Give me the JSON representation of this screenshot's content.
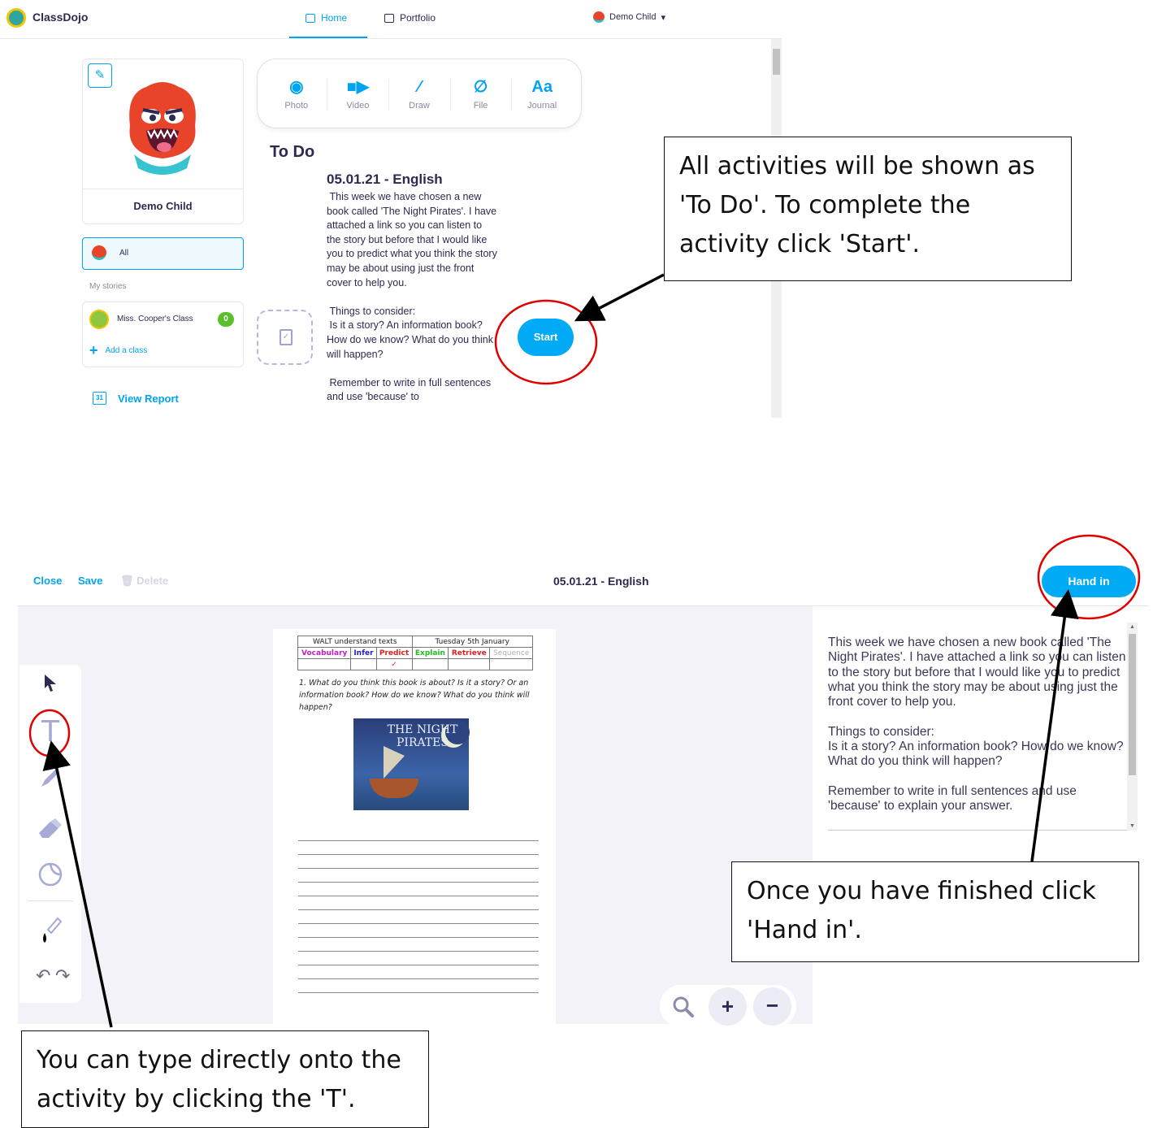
{
  "top_screen": {
    "app_name": "ClassDojo",
    "nav": {
      "home": "Home",
      "portfolio": "Portfolio"
    },
    "user_menu": "Demo Child",
    "profile": {
      "name": "Demo Child",
      "edit_icon": "pencil-icon"
    },
    "sidebar": {
      "all_label": "All",
      "my_stories": "My stories",
      "class_name": "Miss. Cooper's Class",
      "class_badge": "0",
      "add_class": "Add a class",
      "view_report": "View Report",
      "calendar_day": "31"
    },
    "post_options": [
      {
        "label": "Photo",
        "icon": "camera-icon",
        "glyph": "◉"
      },
      {
        "label": "Video",
        "icon": "video-icon",
        "glyph": "■▶"
      },
      {
        "label": "Draw",
        "icon": "brush-icon",
        "glyph": "⁄"
      },
      {
        "label": "File",
        "icon": "paperclip-icon",
        "glyph": "∅"
      },
      {
        "label": "Journal",
        "icon": "text-icon",
        "glyph": "Aa"
      }
    ],
    "todo_heading": "To Do",
    "activity": {
      "title": "05.01.21 - English",
      "body": " This week we have chosen a new book called 'The Night Pirates'. I have attached a link so you can listen to the story but before that I would like you to predict what you think the story may be about using just the front cover to help you.\n\n Things to consider:\n Is it a story? An information book? How do we know? What do you think will happen?\n\n Remember to write in full sentences and use 'because' to",
      "start_label": "Start"
    }
  },
  "bottom_screen": {
    "close": "Close",
    "save": "Save",
    "delete": "Delete",
    "title": "05.01.21 - English",
    "hand_in": "Hand in",
    "tools": [
      "select-arrow-icon",
      "text-tool-icon",
      "pen-icon",
      "eraser-icon",
      "sticker-icon",
      "color-dropper-icon",
      "undo-icon",
      "redo-icon"
    ],
    "text_tool_glyph": "T",
    "worksheet": {
      "walt": "WALT understand texts",
      "date": "Tuesday 5th January",
      "skills": [
        "Vocabulary",
        "Infer",
        "Predict",
        "Explain",
        "Retrieve",
        "Sequence"
      ],
      "skill_colors": [
        "#c020c0",
        "#2020d0",
        "#e02020",
        "#20c020",
        "#e02020",
        "#b0b0b0"
      ],
      "tick": "✓",
      "question": "1. What do you think this book is about? Is it a story? Or an information book? How do we know? What do you think will happen?",
      "book_title": "THE NIGHT PIRATES"
    },
    "description": "This week we have chosen a new book called 'The Night Pirates'. I have attached a link so you can listen to the story but before that I would like you to predict what you think the story may be about using just the front cover to help you.\n\nThings to consider:\nIs it a story? An information book? How do we know? What do you think will happen?\n\nRemember to write in full sentences and use 'because' to explain your answer."
  },
  "annotations": {
    "todo_note": "All activities will be shown as 'To Do'. To complete the activity click 'Start'.",
    "handin_note": "Once you have finished click 'Hand in'.",
    "text_tool_note": "You can type directly onto the activity by clicking the 'T'.",
    "highlight_color": "#e00000"
  }
}
